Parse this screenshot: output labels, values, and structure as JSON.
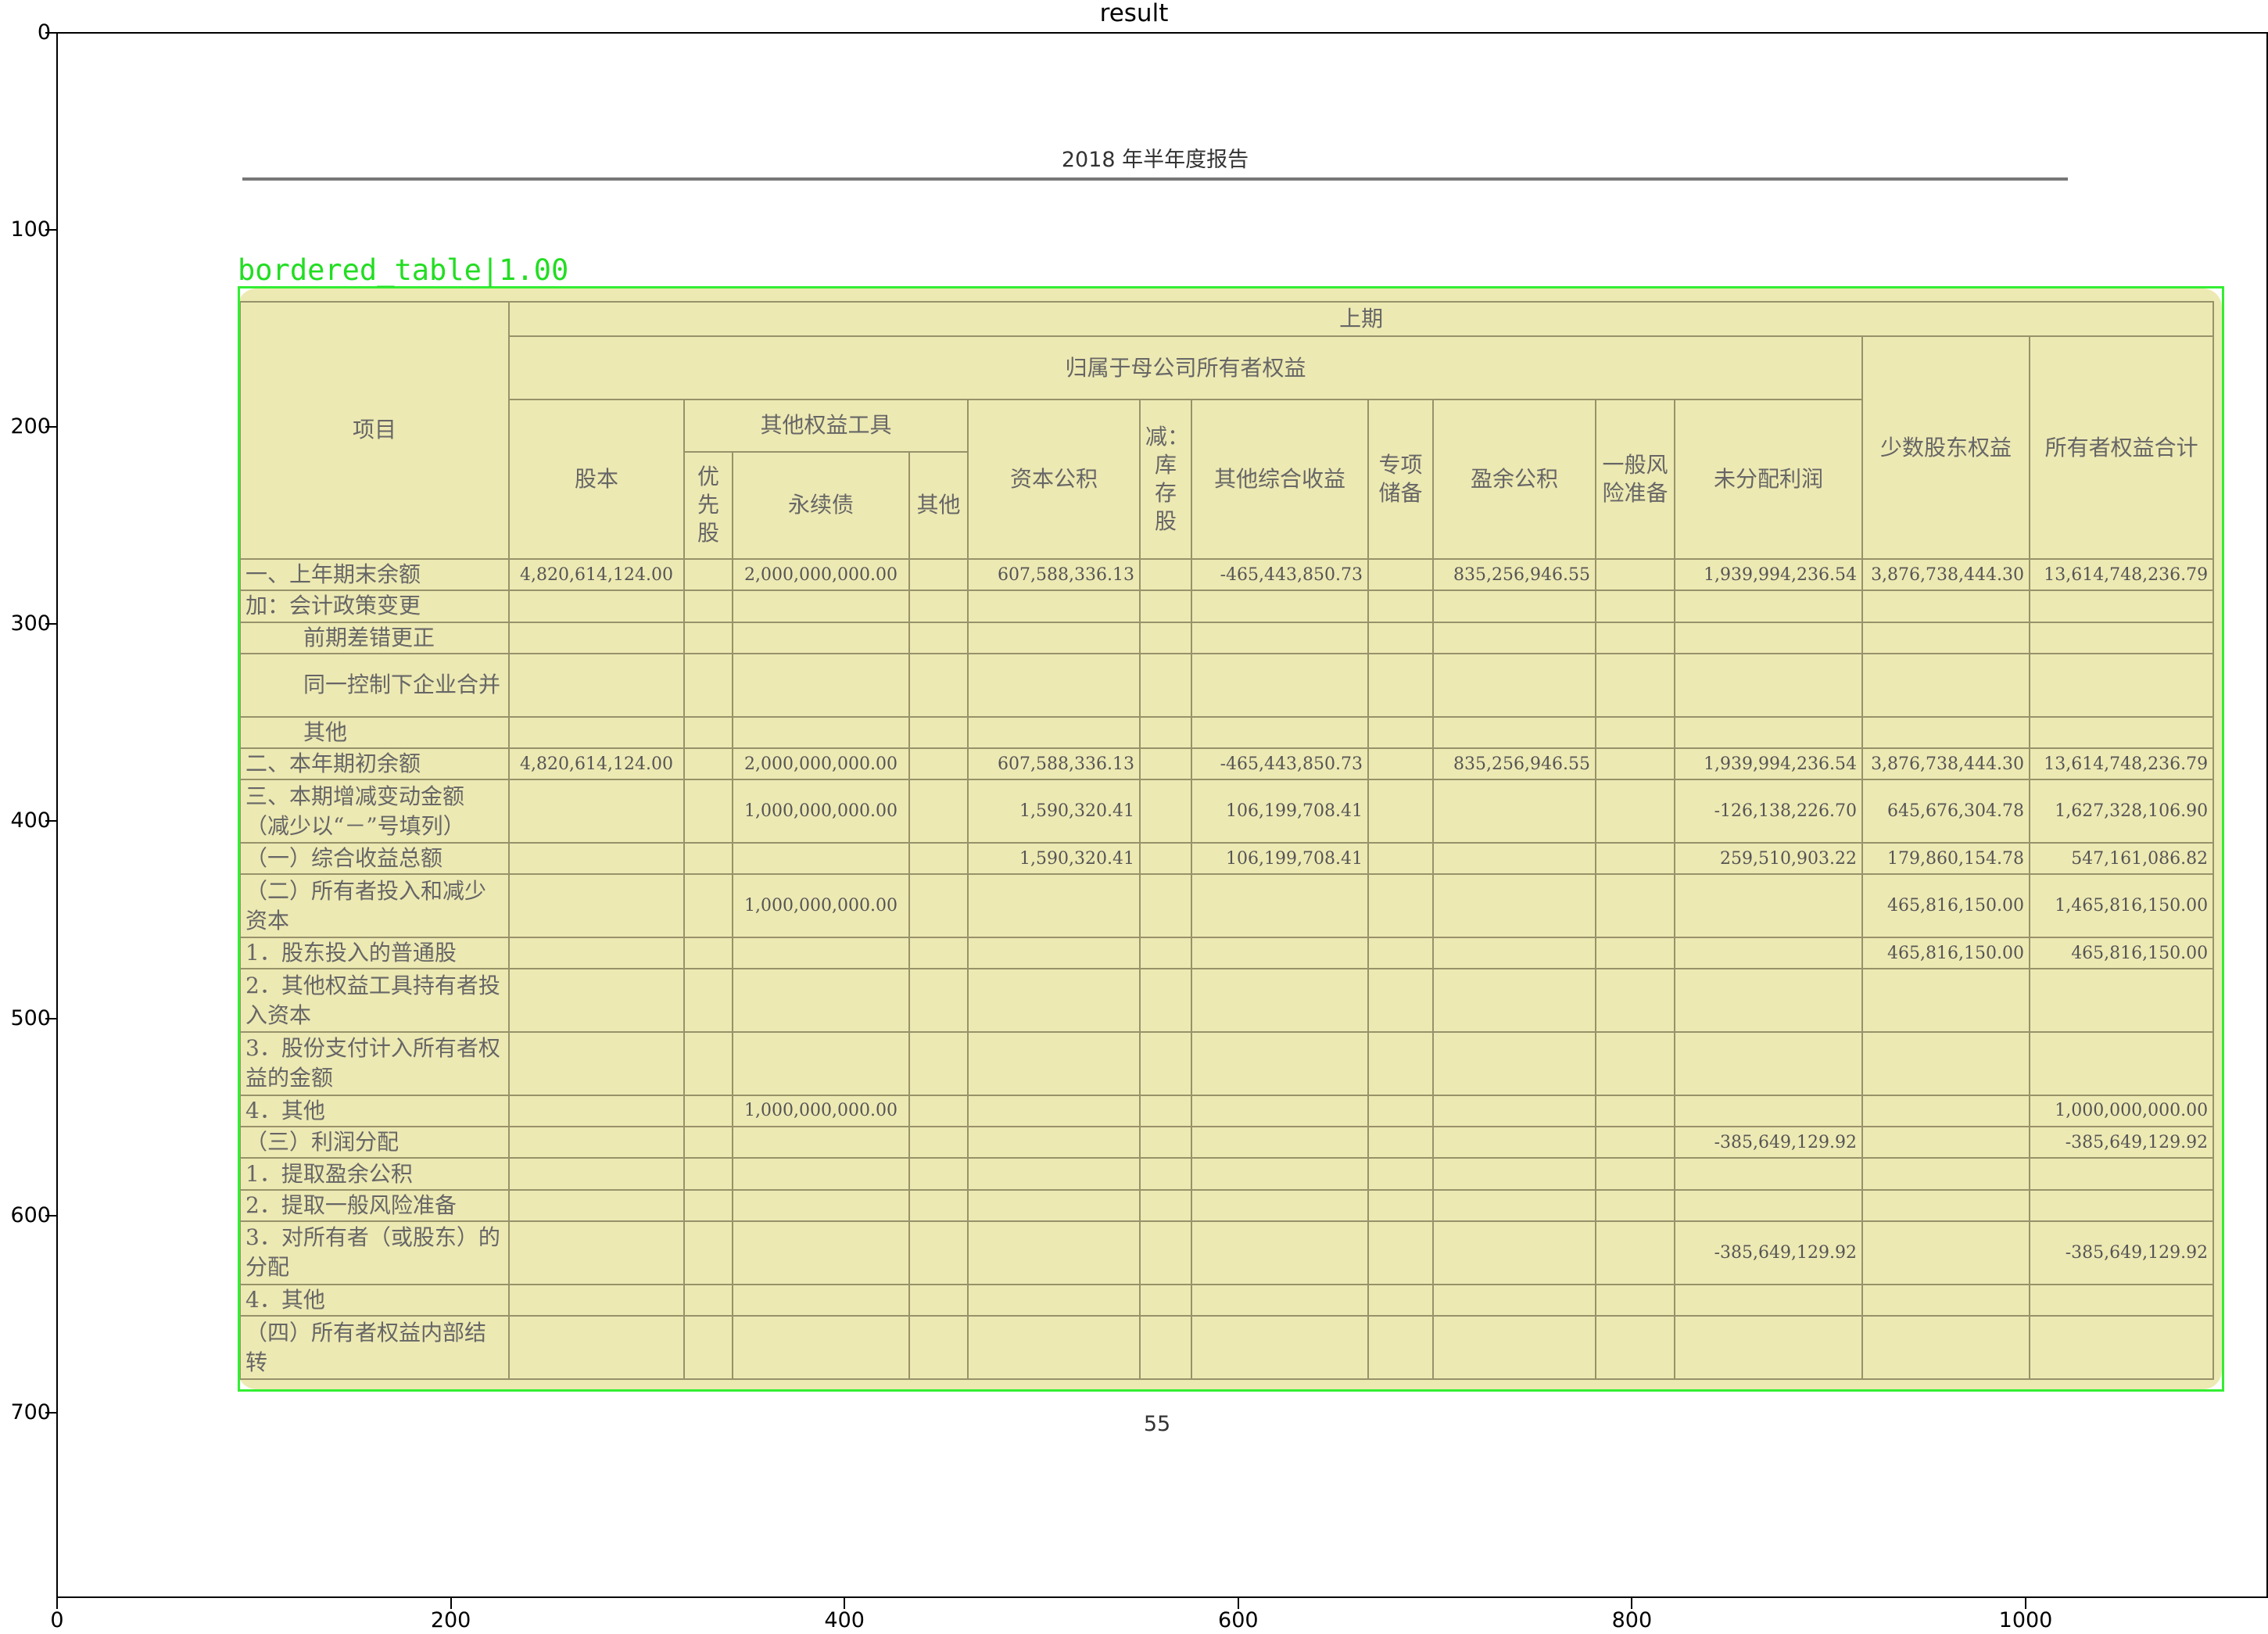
{
  "figure": {
    "title": "result",
    "y_ticks": [
      "0",
      "100",
      "200",
      "300",
      "400",
      "500",
      "600",
      "700"
    ],
    "x_ticks": [
      "0",
      "200",
      "400",
      "600",
      "800",
      "1000"
    ]
  },
  "document": {
    "header": "2018 年半年度报告",
    "page_number": "55"
  },
  "detection": {
    "label": "bordered_table|1.00"
  },
  "table": {
    "headers": {
      "item": "项目",
      "period": "上期",
      "parent_equity": "归属于母公司所有者权益",
      "other_equity_tools": "其他权益工具",
      "share_capital": "股本",
      "preferred_stock": "优先股",
      "perpetual_bond": "永续债",
      "other": "其他",
      "capital_reserve": "资本公积",
      "treasury_stock": "减：库存股",
      "oci": "其他综合收益",
      "special_reserve": "专项储备",
      "surplus_reserve": "盈余公积",
      "general_risk_reserve": "一般风险准备",
      "retained_earnings": "未分配利润",
      "minority_interest": "少数股东权益",
      "total_equity": "所有者权益合计"
    },
    "rows": [
      {
        "label": "一、上年期末余额",
        "share_capital": "4,820,614,124.00",
        "perpetual_bond": "2,000,000,000.00",
        "capital_reserve": "607,588,336.13",
        "oci": "-465,443,850.73",
        "surplus_reserve": "835,256,946.55",
        "retained_earnings": "1,939,994,236.54",
        "minority_interest": "3,876,738,444.30",
        "total": "13,614,748,236.79"
      },
      {
        "label": "加：会计政策变更"
      },
      {
        "label": "前期差错更正",
        "indent": true
      },
      {
        "label": "同一控制下企业合并",
        "indent": true
      },
      {
        "label": "其他",
        "indent": true
      },
      {
        "label": "二、本年期初余额",
        "share_capital": "4,820,614,124.00",
        "perpetual_bond": "2,000,000,000.00",
        "capital_reserve": "607,588,336.13",
        "oci": "-465,443,850.73",
        "surplus_reserve": "835,256,946.55",
        "retained_earnings": "1,939,994,236.54",
        "minority_interest": "3,876,738,444.30",
        "total": "13,614,748,236.79"
      },
      {
        "label": "三、本期增减变动金额（减少以“－”号填列）",
        "perpetual_bond": "1,000,000,000.00",
        "capital_reserve": "1,590,320.41",
        "oci": "106,199,708.41",
        "retained_earnings": "-126,138,226.70",
        "minority_interest": "645,676,304.78",
        "total": "1,627,328,106.90"
      },
      {
        "label": "（一）综合收益总额",
        "capital_reserve": "1,590,320.41",
        "oci": "106,199,708.41",
        "retained_earnings": "259,510,903.22",
        "minority_interest": "179,860,154.78",
        "total": "547,161,086.82"
      },
      {
        "label": "（二）所有者投入和减少资本",
        "perpetual_bond": "1,000,000,000.00",
        "minority_interest": "465,816,150.00",
        "total": "1,465,816,150.00"
      },
      {
        "label": "1．股东投入的普通股",
        "minority_interest": "465,816,150.00",
        "total": "465,816,150.00"
      },
      {
        "label": "2．其他权益工具持有者投入资本"
      },
      {
        "label": "3．股份支付计入所有者权益的金额"
      },
      {
        "label": "4．其他",
        "perpetual_bond": "1,000,000,000.00",
        "total": "1,000,000,000.00"
      },
      {
        "label": "（三）利润分配",
        "retained_earnings": "-385,649,129.92",
        "total": "-385,649,129.92"
      },
      {
        "label": "1．提取盈余公积"
      },
      {
        "label": "2．提取一般风险准备"
      },
      {
        "label": "3．对所有者（或股东）的分配",
        "retained_earnings": "-385,649,129.92",
        "total": "-385,649,129.92"
      },
      {
        "label": "4．其他"
      },
      {
        "label": "（四）所有者权益内部结转"
      }
    ]
  }
}
